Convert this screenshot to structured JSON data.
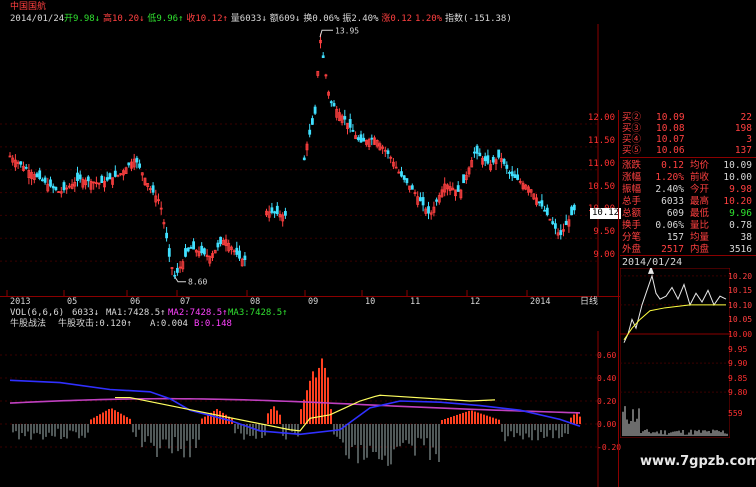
{
  "app": {
    "title": "中国国航",
    "watermark": "www.7gpzb.com"
  },
  "info_bar": {
    "date": "2014/01/24",
    "items": [
      {
        "label": "开",
        "value": "9.98",
        "arrow": "↓",
        "color": "#30e030"
      },
      {
        "label": "高",
        "value": "10.20",
        "arrow": "↓",
        "color": "#ff4040"
      },
      {
        "label": "低",
        "value": "9.96",
        "arrow": "↑",
        "color": "#30e030"
      },
      {
        "label": "收",
        "value": "10.12",
        "arrow": "↑",
        "color": "#ff4040"
      },
      {
        "label": "量",
        "value": "6033",
        "arrow": "↓",
        "color": "#d8d8d8"
      },
      {
        "label": "额",
        "value": "609",
        "arrow": "↓",
        "color": "#d8d8d8"
      },
      {
        "label": "换",
        "value": "0.06%",
        "arrow": "",
        "color": "#d8d8d8"
      },
      {
        "label": "振",
        "value": "2.40%",
        "arrow": "",
        "color": "#d8d8d8"
      },
      {
        "label": "涨",
        "value": "0.12",
        "arrow": "",
        "color": "#ff4040"
      },
      {
        "label": "",
        "value": "1.20%",
        "arrow": "",
        "color": "#ff4040"
      },
      {
        "label": "指数",
        "value": "(-151.38)",
        "arrow": "",
        "color": "#d8d8d8"
      }
    ]
  },
  "candle_chart": {
    "high_label": "13.95",
    "low_label": "8.60",
    "current_price": "10.12",
    "y_ticks": [
      "12.00",
      "11.50",
      "11.00",
      "10.50",
      "10.00",
      "9.50",
      "9.00"
    ],
    "x_ticks": [
      "2013",
      "05",
      "06",
      "07",
      "08",
      "09",
      "10",
      "11",
      "12",
      "2014"
    ],
    "period_label": "日线"
  },
  "volume_bar": {
    "vol_legend": "VOL(6,6,6)",
    "vol_value": "6033↓",
    "ma1": "MA1:7428.5↑",
    "ma2": "MA2:7428.5↑",
    "ma3": "MA3:7428.5↑"
  },
  "indicator": {
    "name": "牛股战法",
    "legend": "牛股攻击:0.120↑",
    "a_value": "A:0.004",
    "b_value": "B:0.148",
    "y_ticks": [
      "0.60",
      "0.40",
      "0.20",
      "0.00",
      "-0.20"
    ]
  },
  "order_book": {
    "rows": [
      {
        "label": "买②",
        "price": "10.09",
        "vol": "22"
      },
      {
        "label": "买③",
        "price": "10.08",
        "vol": "198"
      },
      {
        "label": "买④",
        "price": "10.07",
        "vol": "3"
      },
      {
        "label": "买⑤",
        "price": "10.06",
        "vol": "137"
      }
    ]
  },
  "quote_stats": {
    "rows": [
      {
        "l1": "涨跌",
        "v1": "0.12",
        "l2": "均价",
        "v2": "10.09"
      },
      {
        "l1": "涨幅",
        "v1": "1.20%",
        "l2": "前收",
        "v2": "10.00"
      },
      {
        "l1": "振幅",
        "v1": "2.40%",
        "l2": "今开",
        "v2": "9.98"
      },
      {
        "l1": "总手",
        "v1": "6033",
        "l2": "最高",
        "v2": "10.20"
      },
      {
        "l1": "总额",
        "v1": "609",
        "l2": "最低",
        "v2": "9.96"
      },
      {
        "l1": "换手",
        "v1": "0.06%",
        "l2": "量比",
        "v2": "0.78"
      },
      {
        "l1": "分笔",
        "v1": "157",
        "l2": "均量",
        "v2": "38"
      },
      {
        "l1": "外盘",
        "v1": "2517",
        "l2": "内盘",
        "v2": "3516"
      }
    ]
  },
  "intraday": {
    "date": "2014/01/24",
    "y_ticks": [
      "10.20",
      "10.15",
      "10.10",
      "10.05",
      "10.00",
      "9.95",
      "9.90",
      "9.85",
      "9.80"
    ],
    "vol_tick": "559"
  },
  "colors": {
    "up": "#ff4040",
    "down": "#40e0ff",
    "grid": "#8b0000",
    "ma": "#c040c0"
  }
}
